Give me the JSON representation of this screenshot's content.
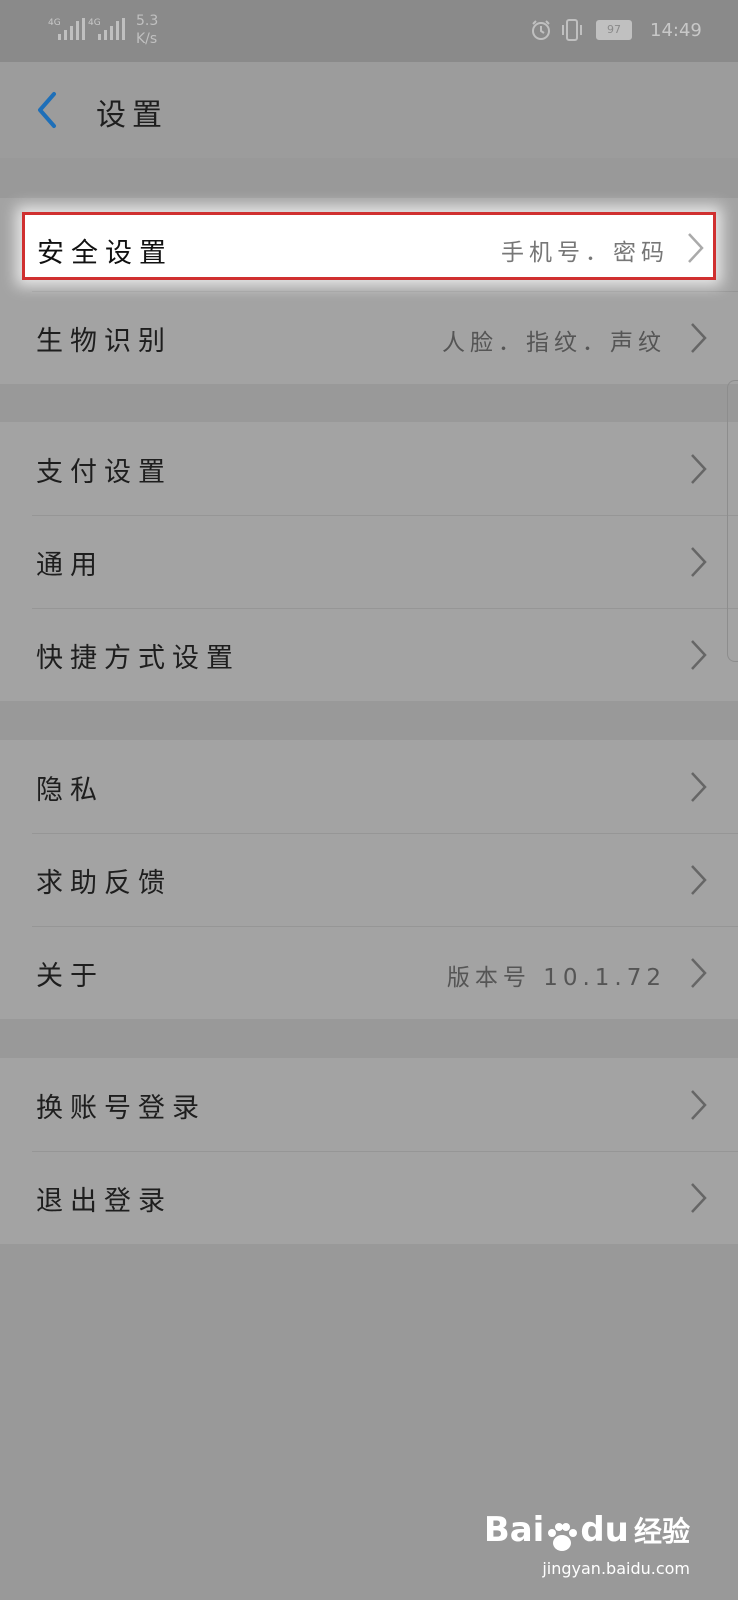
{
  "status_bar": {
    "signal1_label": "4G",
    "signal2_label": "4G",
    "speed_value": "5.3",
    "speed_unit": "K/s",
    "battery": "97",
    "time": "14:49"
  },
  "header": {
    "title": "设置"
  },
  "groups": [
    {
      "items": [
        {
          "label": "安全设置",
          "value": "手机号．密码",
          "highlighted": true
        },
        {
          "label": "生物识别",
          "value": "人脸．指纹．声纹"
        }
      ]
    },
    {
      "items": [
        {
          "label": "支付设置",
          "value": ""
        },
        {
          "label": "通用",
          "value": ""
        },
        {
          "label": "快捷方式设置",
          "value": ""
        }
      ]
    },
    {
      "items": [
        {
          "label": "隐私",
          "value": ""
        },
        {
          "label": "求助反馈",
          "value": ""
        },
        {
          "label": "关于",
          "value": "版本号 10.1.72"
        }
      ]
    },
    {
      "items": [
        {
          "label": "换账号登录",
          "value": ""
        },
        {
          "label": "退出登录",
          "value": ""
        }
      ]
    }
  ],
  "watermark": {
    "brand_a": "Bai",
    "brand_b": "du",
    "product": "经验",
    "url": "jingyan.baidu.com"
  },
  "colors": {
    "accent": "#1e6fb8",
    "highlight_border": "#d03030"
  }
}
